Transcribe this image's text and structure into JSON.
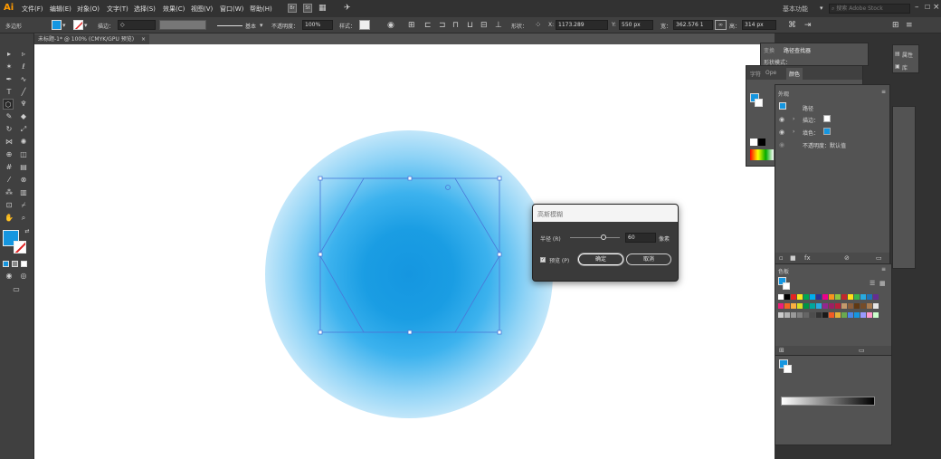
{
  "app": {
    "logo": "Ai",
    "menus": [
      "文件(F)",
      "编辑(E)",
      "对象(O)",
      "文字(T)",
      "选择(S)",
      "效果(C)",
      "视图(V)",
      "窗口(W)",
      "帮助(H)"
    ],
    "workspace": "基本功能",
    "search_placeholder": "搜索 Adobe Stock"
  },
  "control_bar": {
    "object_type": "多边形",
    "stroke_label": "描边：",
    "stroke_style": "基本",
    "opacity_label": "不透明度：",
    "opacity_value": "100%",
    "style_label": "样式：",
    "shape_label": "形状：",
    "x_label": "X:",
    "x_value": "1173.289",
    "y_label": "Y:",
    "y_value": "550 px",
    "w_label": "宽：",
    "w_value": "362.576 1",
    "h_label": "高：",
    "h_value": "314 px"
  },
  "document": {
    "tab_title": "未标题-1* @ 100% (CMYK/GPU 预览)"
  },
  "colors": {
    "fill": "#1596e0",
    "selection": "#4a78d8",
    "ui_dark": "#323232",
    "ui_mid": "#404040",
    "ui_panel": "#535353"
  },
  "dialog": {
    "title": "高斯模糊",
    "radius_label": "半径 (R)",
    "radius_value": "60",
    "radius_unit": "像素",
    "preview_label": "预览 (P)",
    "preview_checked": true,
    "ok_label": "确定",
    "cancel_label": "取消"
  },
  "panels": {
    "top_tabs": [
      "变换",
      "路径查找器"
    ],
    "shape_mode_label": "形状模式：",
    "props": [
      "属性",
      "库"
    ],
    "color_tabs": [
      "字符",
      "Ope",
      "颜色"
    ],
    "appearance": {
      "title": "外观",
      "object": "路径",
      "rows": [
        "描边：",
        "填色：",
        "不透明度：默认值"
      ]
    },
    "swatches_title": "色板"
  },
  "icons": [
    "selection-icon",
    "direct-selection-icon",
    "magic-wand-icon",
    "lasso-icon",
    "pen-icon",
    "curvature-icon",
    "type-icon",
    "line-icon",
    "polygon-icon",
    "paintbrush-icon",
    "pencil-icon",
    "eraser-icon",
    "rotate-icon",
    "scale-icon",
    "width-icon",
    "warp-icon",
    "shape-builder-icon",
    "perspective-icon",
    "mesh-icon",
    "gradient-icon",
    "eyedropper-icon",
    "blend-icon",
    "symbol-sprayer-icon",
    "graph-icon",
    "artboard-icon",
    "slice-icon",
    "hand-icon",
    "zoom-icon"
  ]
}
